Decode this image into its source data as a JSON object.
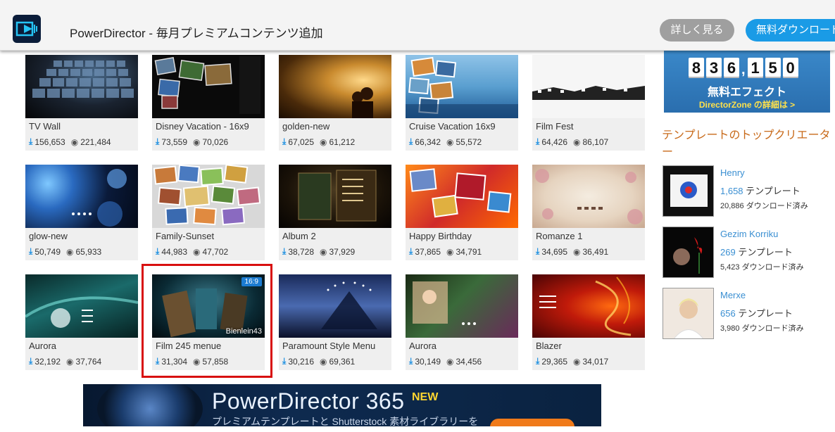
{
  "header": {
    "title": "PowerDirector - 毎月プレミアムコンテンツ追加",
    "more_label": "詳しく見る",
    "download_label": "無料ダウンロード"
  },
  "templates": [
    {
      "title": "TV Wall",
      "downloads": "156,653",
      "views": "221,484"
    },
    {
      "title": "Disney Vacation - 16x9",
      "downloads": "73,559",
      "views": "70,026"
    },
    {
      "title": "golden-new",
      "downloads": "67,025",
      "views": "61,212"
    },
    {
      "title": "Cruise Vacation 16x9",
      "downloads": "66,342",
      "views": "55,572"
    },
    {
      "title": "Film Fest",
      "downloads": "64,426",
      "views": "86,107"
    },
    {
      "title": "glow-new",
      "downloads": "50,749",
      "views": "65,933"
    },
    {
      "title": "Family-Sunset",
      "downloads": "44,983",
      "views": "47,702"
    },
    {
      "title": "Album 2",
      "downloads": "38,728",
      "views": "37,929"
    },
    {
      "title": "Happy Birthday",
      "downloads": "37,865",
      "views": "34,791"
    },
    {
      "title": "Romanze 1",
      "downloads": "34,695",
      "views": "36,491"
    },
    {
      "title": "Aurora",
      "downloads": "32,192",
      "views": "37,764"
    },
    {
      "title": "Film 245 menue",
      "downloads": "31,304",
      "views": "57,858",
      "ratio_tag": "16:9",
      "author_tag": "Bienlein43"
    },
    {
      "title": "Paramount Style Menu",
      "downloads": "30,216",
      "views": "69,361"
    },
    {
      "title": "Aurora",
      "downloads": "30,149",
      "views": "34,456"
    },
    {
      "title": "Blazer",
      "downloads": "29,365",
      "views": "34,017"
    }
  ],
  "counter": {
    "digits": [
      "8",
      "3",
      "6",
      "1",
      "5",
      "0"
    ],
    "label": "無料エフェクト",
    "link": "DirectorZone の詳細は >"
  },
  "creators": {
    "heading": "テンプレートのトップクリエーター",
    "items": [
      {
        "name": "Henry",
        "count": "1,658",
        "count_suffix": " テンプレート",
        "downloads": "20,886 ダウンロード済み"
      },
      {
        "name": "Gezim Korriku",
        "count": "269",
        "count_suffix": " テンプレート",
        "downloads": "5,423 ダウンロード済み"
      },
      {
        "name": "Merxe",
        "count": "656",
        "count_suffix": " テンプレート",
        "downloads": "3,980 ダウンロード済み"
      }
    ]
  },
  "ad": {
    "title": "PowerDirector 365",
    "badge": "NEW",
    "subtitle": "プレミアムテンプレートと Shutterstock 素材ライブラリーを"
  },
  "colors": {
    "accent_blue": "#1a9be6",
    "highlight_red": "#d80f0f",
    "heading_orange": "#c86a1a"
  }
}
